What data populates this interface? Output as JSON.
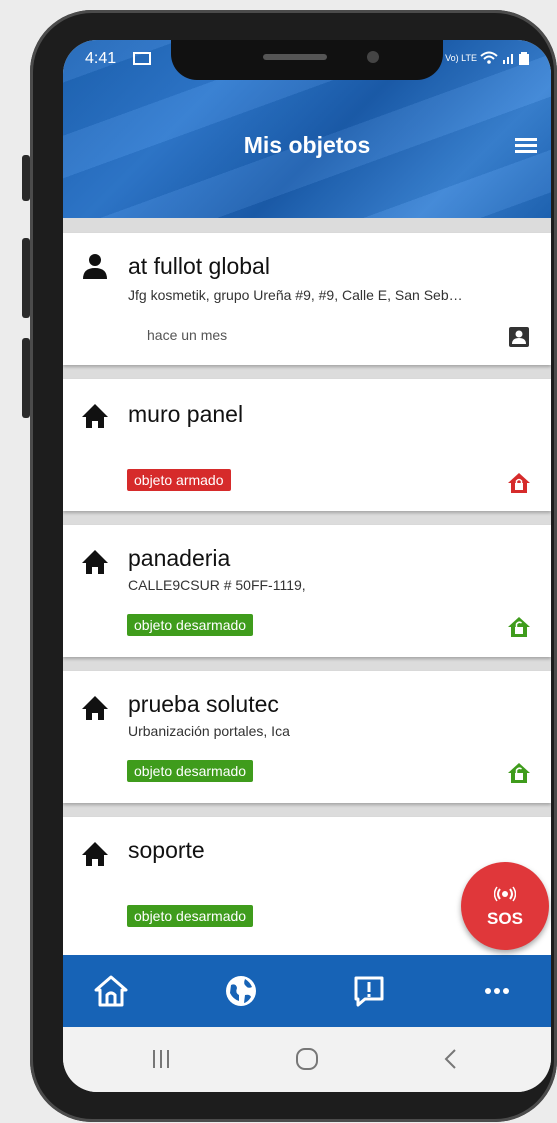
{
  "status_bar": {
    "time": "4:41",
    "indicators": "Vo) LTE"
  },
  "header": {
    "title": "Mis objetos"
  },
  "objects": [
    {
      "name": "at fullot global",
      "address": "Jfg kosmetik, grupo Ureña #9, #9, Calle E, San Seb…",
      "time": "hace un mes",
      "icon": "person-icon",
      "action_icon": "contact-card-icon"
    },
    {
      "name": "muro panel",
      "address": "",
      "status": "objeto armado",
      "status_color": "#d62b2b",
      "icon": "home-icon",
      "action_icon": "home-armed-icon"
    },
    {
      "name": "panaderia",
      "address": "CALLE9CSUR # 50FF-1119,",
      "status": "objeto desarmado",
      "status_color": "#3f9c1c",
      "icon": "home-icon",
      "action_icon": "home-disarmed-icon"
    },
    {
      "name": "prueba solutec",
      "address": "Urbanización portales, Ica",
      "status": "objeto desarmado",
      "status_color": "#3f9c1c",
      "icon": "home-icon",
      "action_icon": "home-disarmed-icon"
    },
    {
      "name": "soporte",
      "address": "",
      "status": "objeto desarmado",
      "status_color": "#3f9c1c",
      "icon": "home-icon"
    }
  ],
  "sos": {
    "label": "SOS",
    "color": "#e0373a"
  },
  "bottom_nav": {
    "items": [
      "home-icon",
      "globe-icon",
      "alert-message-icon",
      "more-icon"
    ],
    "color": "#1763b6"
  },
  "system_nav": {
    "items": [
      "recents-icon",
      "home-button-icon",
      "back-icon"
    ]
  }
}
